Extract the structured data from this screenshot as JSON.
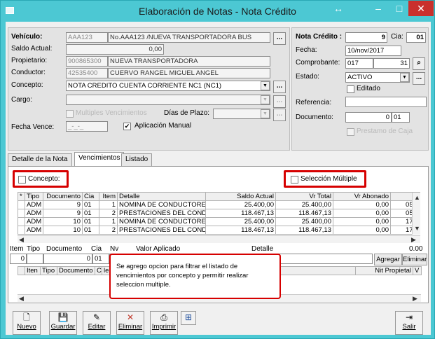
{
  "window": {
    "title": "Elaboración de Notas - Nota Crédito",
    "controls": {
      "move": "↔",
      "minimize": "–",
      "maximize": "□",
      "close": "✕"
    }
  },
  "form": {
    "vehiculo_label": "Vehículo:",
    "vehiculo_code": "AAA123",
    "vehiculo_desc": "No.AAA123 /NUEVA TRANSPORTADORA BUS",
    "saldo_label": "Saldo Actual:",
    "saldo_value": "0,00",
    "propietario_label": "Propietario:",
    "propietario_id": "900865300",
    "propietario_name": "NUEVA TRANSPORTADORA",
    "conductor_label": "Conductor:",
    "conductor_id": "42535400",
    "conductor_name": "CUERVO RANGEL MIGUEL ANGEL",
    "concepto_label": "Concepto:",
    "concepto_value": "NOTA CREDITO CUENTA CORRIENTE NC1  (NC1)",
    "cargo_label": "Cargo:",
    "cargo_value": "",
    "multiples_label": "Multiples Vencimientos",
    "dias_plazo_label": "Días de Plazo:",
    "fecha_vence_label": "Fecha Vence:",
    "fecha_vence_value": "_-_-_",
    "aplicacion_manual_label": "Aplicación Manual"
  },
  "nota": {
    "nota_credito_label": "Nota Crédito :",
    "nota_numero": "9",
    "cia_label": "Cia:",
    "cia_value": "01",
    "fecha_label": "Fecha:",
    "fecha_value": "10/nov/2017",
    "comprobante_label": "Comprobante:",
    "comprobante_value": "017",
    "comprobante_num": "31",
    "estado_label": "Estado:",
    "estado_value": "ACTIVO",
    "editado_label": "Editado",
    "referencia_label": "Referencia:",
    "referencia_value": "",
    "documento_label": "Documento:",
    "documento_num": "0",
    "documento_cia": "01",
    "prestamo_label": "Prestamo de Caja"
  },
  "tabs": [
    "Detalle de la Nota",
    "Vencimientos",
    "Listado"
  ],
  "filters": {
    "concepto_label": "Concepto:",
    "seleccion_multiple_label": "Selección Múltiple"
  },
  "grid": {
    "columns": [
      "*",
      "Tipo",
      "Documento",
      "Cia",
      "Item",
      "Detalle",
      "Saldo Actual",
      "Vr Total",
      "Vr Abonado",
      ""
    ],
    "rows": [
      {
        "tipo": "ADM",
        "documento": "9",
        "cia": "01",
        "item": "1",
        "detalle": "NOMINA DE CONDUCTORES (",
        "saldo": "25.400,00",
        "total": "25.400,00",
        "abonado": "0,00",
        "fecha": "05/c"
      },
      {
        "tipo": "ADM",
        "documento": "9",
        "cia": "01",
        "item": "2",
        "detalle": "PRESTACIONES DEL CONDUC",
        "saldo": "118.467,13",
        "total": "118.467,13",
        "abonado": "0,00",
        "fecha": "05/c"
      },
      {
        "tipo": "ADM",
        "documento": "10",
        "cia": "01",
        "item": "1",
        "detalle": "NOMINA DE CONDUCTORES (",
        "saldo": "25.400,00",
        "total": "25.400,00",
        "abonado": "0,00",
        "fecha": "17/c"
      },
      {
        "tipo": "ADM",
        "documento": "10",
        "cia": "01",
        "item": "2",
        "detalle": "PRESTACIONES DEL CONDUC",
        "saldo": "118.467,13",
        "total": "118.467,13",
        "abonado": "0,00",
        "fecha": "17/c"
      }
    ]
  },
  "entry": {
    "headers": [
      "Item",
      "Tipo",
      "Documento",
      "Cia",
      "Nv",
      "Valor Aplicado",
      "Detalle"
    ],
    "total": "0.00",
    "item": "0",
    "documento": "0",
    "cia": "01",
    "nv": "0",
    "valor": "0",
    "agregar_label": "Agregar",
    "eliminar_label": "Eliminar"
  },
  "lower_grid": {
    "columns": [
      "Iten",
      "Tipo",
      "Documento",
      "C",
      "le",
      "Nit Propietal",
      "V"
    ]
  },
  "note": {
    "text": "Se agrego opcion para filtrar el listado de vencimientos por concepto y permitir realizar seleccion multiple."
  },
  "toolbar": {
    "nuevo": "Nuevo",
    "guardar": "Guardar",
    "editar": "Editar",
    "eliminar": "Eliminar",
    "imprimir": "Imprimir",
    "salir": "Salir"
  }
}
